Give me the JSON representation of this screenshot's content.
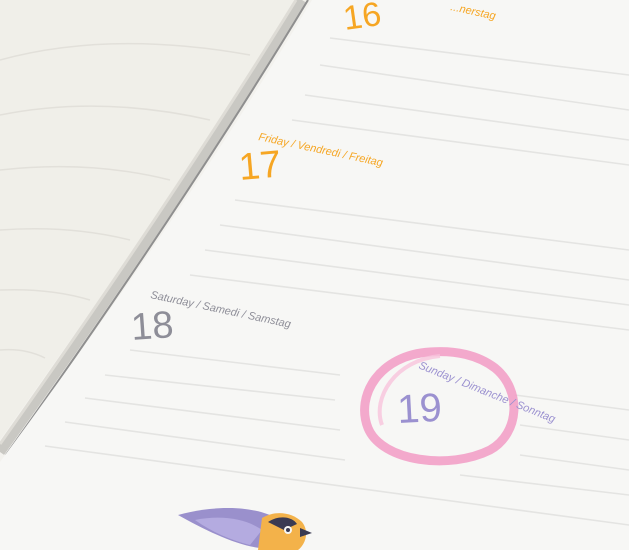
{
  "planner": {
    "days": [
      {
        "name": "thursday",
        "label": "...nerstag",
        "number": "16",
        "color": "#f6a623"
      },
      {
        "name": "friday",
        "label": "Friday / Vendredi / Freitag",
        "number": "17",
        "color": "#f6a623"
      },
      {
        "name": "saturday",
        "label": "Saturday / Samedi / Samstag",
        "number": "18",
        "color": "#8e8e98"
      },
      {
        "name": "sunday",
        "label": "Sunday / Dimanche / Sonntag",
        "number": "19",
        "color": "#9b91d0"
      }
    ],
    "highlight": {
      "day": "19",
      "marker": "pink-circle",
      "color": "#f2a0c8"
    },
    "bird": {
      "icon": "bird-illustration",
      "colors": [
        "#9a90cc",
        "#f3b24a",
        "#3a3a52"
      ]
    }
  }
}
